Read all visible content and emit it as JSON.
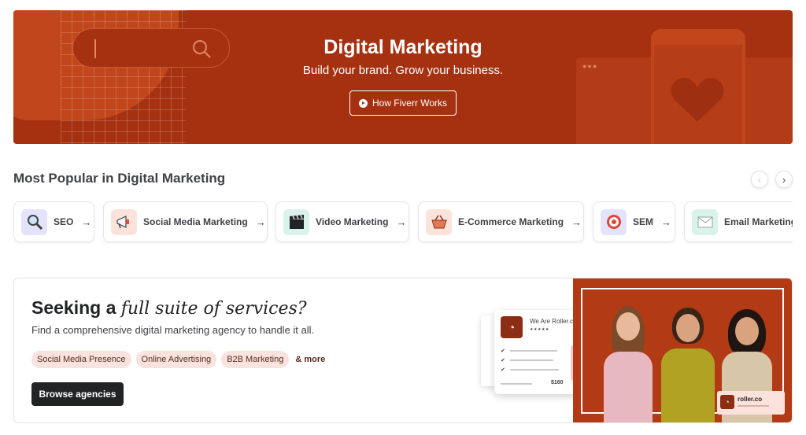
{
  "hero": {
    "title": "Digital Marketing",
    "subtitle": "Build your brand. Grow your business.",
    "how_button_label": "How Fiverr Works",
    "background_color": "#a63111"
  },
  "popular": {
    "title": "Most Popular in Digital Marketing",
    "prev_icon": "chevron-left-icon",
    "next_icon": "chevron-right-icon",
    "categories": [
      {
        "label": "SEO",
        "icon": "magnifier-icon",
        "icon_bg": "#e3e4fb"
      },
      {
        "label": "Social Media Marketing",
        "icon": "megaphone-icon",
        "icon_bg": "#fbe3dc"
      },
      {
        "label": "Video Marketing",
        "icon": "clapperboard-icon",
        "icon_bg": "#d9f3ea"
      },
      {
        "label": "E-Commerce Marketing",
        "icon": "basket-icon",
        "icon_bg": "#fbe3dc"
      },
      {
        "label": "SEM",
        "icon": "target-icon",
        "icon_bg": "#e3e4fb"
      },
      {
        "label": "Email Marketing",
        "icon": "envelope-icon",
        "icon_bg": "#d9f3ea"
      }
    ]
  },
  "agency": {
    "heading_plain": "Seeking a ",
    "heading_italic": "full suite of services?",
    "description": "Find a comprehensive digital marketing agency to handle it all.",
    "tags": [
      "Social Media Presence",
      "Online Advertising",
      "B2B Marketing"
    ],
    "more_label": "& more",
    "browse_button_label": "Browse agencies",
    "card_name": "We Are Roller.co",
    "card_price": "$160",
    "badge_name": "roller.co"
  }
}
